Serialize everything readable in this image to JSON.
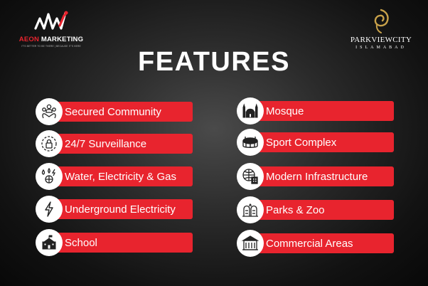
{
  "logos": {
    "aeon": {
      "name_part1": "AEON",
      "name_part2": "MARKETING",
      "tagline": "IT'S BETTER TO BE THERE | BECAUSE IT'S HERE"
    },
    "parkview": {
      "name": "PARKVIEWCITY",
      "city": "ISLAMABAD"
    }
  },
  "title": "FEATURES",
  "features_left": [
    {
      "label": "Secured Community",
      "icon": "community-icon"
    },
    {
      "label": "24/7 Surveillance",
      "icon": "surveillance-icon"
    },
    {
      "label": "Water, Electricity & Gas",
      "icon": "utilities-icon"
    },
    {
      "label": "Underground Electricity",
      "icon": "lightning-icon"
    },
    {
      "label": "School",
      "icon": "school-icon"
    }
  ],
  "features_right": [
    {
      "label": "Mosque",
      "icon": "mosque-icon"
    },
    {
      "label": "Sport Complex",
      "icon": "stadium-icon"
    },
    {
      "label": "Modern Infrastructure",
      "icon": "infrastructure-icon"
    },
    {
      "label": "Parks & Zoo",
      "icon": "park-icon"
    },
    {
      "label": "Commercial Areas",
      "icon": "commercial-icon"
    }
  ],
  "colors": {
    "accent": "#e8242e",
    "background": "#1a1a1a",
    "text": "#ffffff",
    "gold": "#c9a24a"
  }
}
